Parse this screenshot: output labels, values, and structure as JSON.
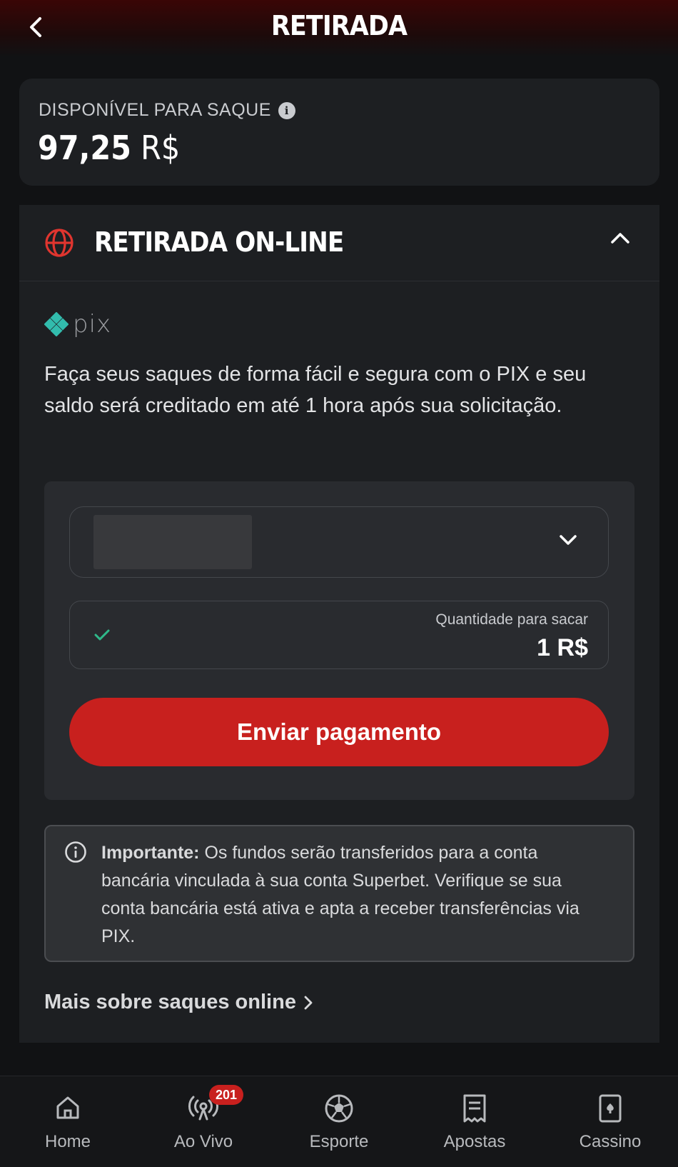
{
  "header": {
    "title": "RETIRADA"
  },
  "balance": {
    "label": "DISPONÍVEL PARA SAQUE",
    "amount": "97,25",
    "currency": "R$"
  },
  "section": {
    "title": "RETIRADA ON-LINE",
    "pix_text": "pix",
    "description": "Faça seus saques de forma fácil e segura com o PIX e seu saldo será creditado em até 1 hora após sua solicitação.",
    "amount_label": "Quantidade para sacar",
    "amount_value": "1 R$",
    "submit_label": "Enviar pagamento",
    "notice_bold": "Importante:",
    "notice_text": " Os fundos serão transferidos para a conta bancária vinculada à sua conta Superbet. Verifique se sua conta bancária está ativa e apta a receber transferências via PIX.",
    "more_link": "Mais sobre saques online"
  },
  "nav": {
    "items": [
      {
        "label": "Home",
        "icon": "home-icon"
      },
      {
        "label": "Ao Vivo",
        "icon": "live-icon",
        "badge": "201"
      },
      {
        "label": "Esporte",
        "icon": "soccer-ball-icon"
      },
      {
        "label": "Apostas",
        "icon": "receipt-icon"
      },
      {
        "label": "Cassino",
        "icon": "card-icon"
      }
    ]
  },
  "colors": {
    "accent": "#c8201e",
    "background": "#111214",
    "card": "#1d1f22",
    "success": "#2fb98a",
    "pix": "#32bcad"
  }
}
